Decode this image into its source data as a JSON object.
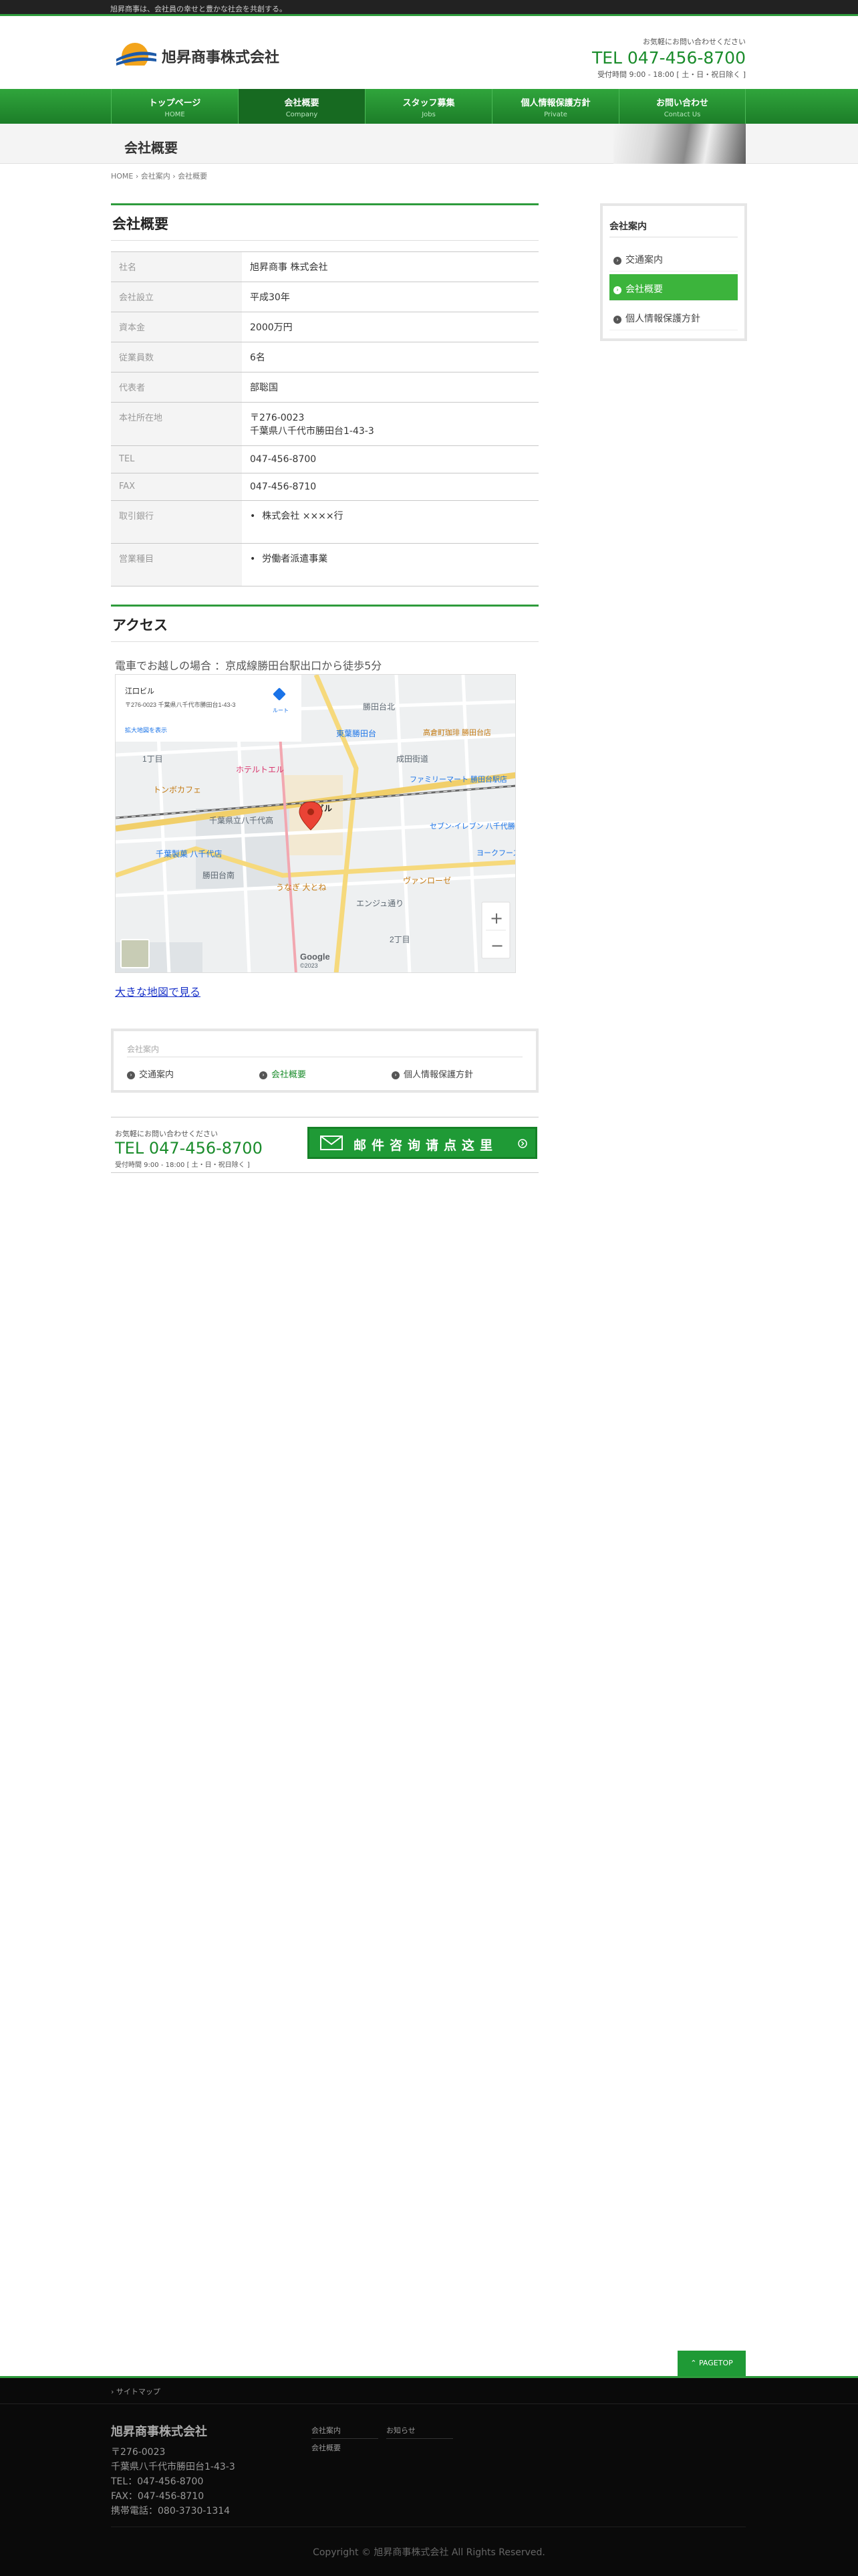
{
  "topbar": {
    "tagline": "旭昇商事は、会社員の幸せと豊かな社会を共創する。"
  },
  "header": {
    "brand": "旭昇商事株式会社",
    "contact_small": "お気軽にお問い合わせください",
    "tel": "TEL 047-456-8700",
    "hours": "受付時間 9:00 - 18:00 [ 土・日・祝日除く ]"
  },
  "nav": [
    {
      "jp": "トップページ",
      "en": "HOME"
    },
    {
      "jp": "会社概要",
      "en": "Company"
    },
    {
      "jp": "スタッフ募集",
      "en": "Jobs"
    },
    {
      "jp": "個人情報保護方針",
      "en": "Private"
    },
    {
      "jp": "お問い合わせ",
      "en": "Contact Us"
    }
  ],
  "page": {
    "title": "会社概要",
    "breadcrumb": "HOME › 会社案内 › 会社概要"
  },
  "company": {
    "heading": "会社概要",
    "rows": [
      {
        "label": "社名",
        "value": "旭昇商事 株式会社"
      },
      {
        "label": "会社設立",
        "value": "平成30年"
      },
      {
        "label": "資本金",
        "value": "2000万円"
      },
      {
        "label": "従業員数",
        "value": "6名"
      },
      {
        "label": "代表者",
        "value": "部聡国"
      },
      {
        "label": "本社所在地",
        "value": "〒276-0023",
        "value2": "千葉県八千代市勝田台1-43-3"
      },
      {
        "label": "TEL",
        "value": "047-456-8700"
      },
      {
        "label": "FAX",
        "value": "047-456-8710"
      },
      {
        "label": "取引銀行",
        "value": "株式会社 ××××行"
      },
      {
        "label": "営業種目",
        "value": "労働者派遣事業"
      }
    ]
  },
  "access": {
    "heading": "アクセス",
    "note": "電車でお越しの場合 ：京成線勝田台駅出口から徒歩5分",
    "map_link": "大きな地図で見る",
    "map": {
      "pin_label": "江口ビル",
      "labels": [
        "勝田台北",
        "東葉勝田台",
        "成田街道",
        "ファミリーマート 勝田台駅店",
        "セブン-イレブン 八千代勝田台駅",
        "高倉町珈琲 勝田台店",
        "ホテルトエル",
        "トンボカフェ",
        "千葉県立八千代高",
        "千葉製菓 八千代店",
        "勝田台南",
        "うなぎ 大とね",
        "ヴァンローゼ",
        "ヨークフーズ",
        "エンジュ通り",
        "1丁目",
        "2丁目",
        "Google",
        "©2023"
      ],
      "zoom_in": "+",
      "zoom_out": "−",
      "info_title": "江口ビル",
      "info_addr": "〒276-0023 千葉県八千代市勝田台1-43-3",
      "info_link": "拡大地図を表示",
      "info_route": "ルート"
    }
  },
  "subnav": {
    "caption": "会社案内",
    "links": [
      "交通案内",
      "会社概要",
      "個人情報保護方針"
    ]
  },
  "cta": {
    "small": "お気軽にお問い合わせください",
    "tel": "TEL 047-456-8700",
    "hours": "受付時間 9:00 - 18:00 [ 土・日・祝日除く ]",
    "mail_label": "邮件咨询请点这里"
  },
  "sidebar": {
    "heading": "会社案内",
    "items": [
      "交通案内",
      "会社概要",
      "個人情報保護方針"
    ]
  },
  "pagetop": "PAGETOP",
  "footer": {
    "sitemap": "› サイトマップ",
    "name": "旭昇商事株式会社",
    "lines": [
      "〒276-0023",
      "千葉県八千代市勝田台1-43-3",
      "TEL：047-456-8700",
      "FAX：047-456-8710",
      "携帯電話：080-3730-1314"
    ],
    "nav_left": [
      "会社案内",
      "会社概要"
    ],
    "nav_right": [
      "お知らせ"
    ],
    "copyright": "Copyright © 旭昇商事株式会社 All Rights Reserved."
  },
  "colors": {
    "accent": "#2e9b3c",
    "active": "#3cb43c",
    "tel": "#1a8c2b",
    "footer": "#0a0a0a"
  }
}
